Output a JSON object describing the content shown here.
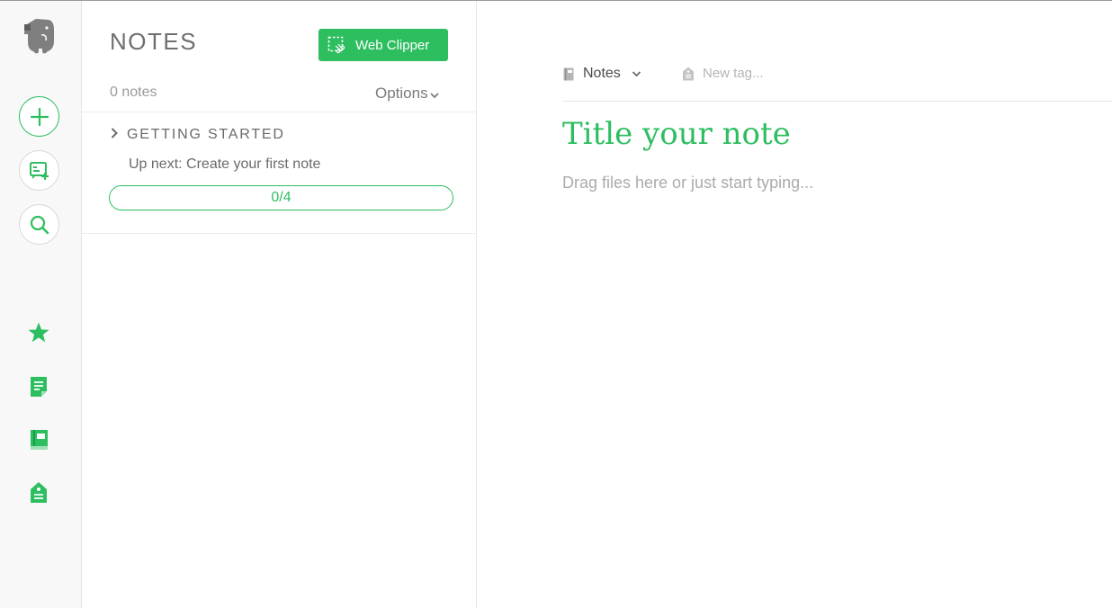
{
  "colors": {
    "accent": "#2dbe60",
    "rail_bg": "#f8f8f8",
    "muted_text": "#9a9a9a"
  },
  "rail": {
    "logo_icon": "evernote-elephant-icon",
    "actions": [
      {
        "name": "new-note-button",
        "icon": "plus-icon"
      },
      {
        "name": "work-chat-button",
        "icon": "chat-icon"
      },
      {
        "name": "search-button",
        "icon": "search-icon"
      }
    ],
    "nav": [
      {
        "name": "shortcuts",
        "icon": "star-icon"
      },
      {
        "name": "notes",
        "icon": "note-icon"
      },
      {
        "name": "notebooks",
        "icon": "notebook-icon"
      },
      {
        "name": "tags",
        "icon": "tag-icon"
      }
    ]
  },
  "notes_panel": {
    "title": "NOTES",
    "web_clipper_label": "Web Clipper",
    "count_label": "0 notes",
    "options_label": "Options",
    "getting_started": {
      "heading": "GETTING STARTED",
      "next_step": "Up next: Create your first note",
      "progress_label": "0/4",
      "progress_fraction": 0
    }
  },
  "editor": {
    "notebook_label": "Notes",
    "tag_placeholder": "New tag...",
    "title_placeholder": "Title your note",
    "body_placeholder": "Drag files here or just start typing..."
  }
}
